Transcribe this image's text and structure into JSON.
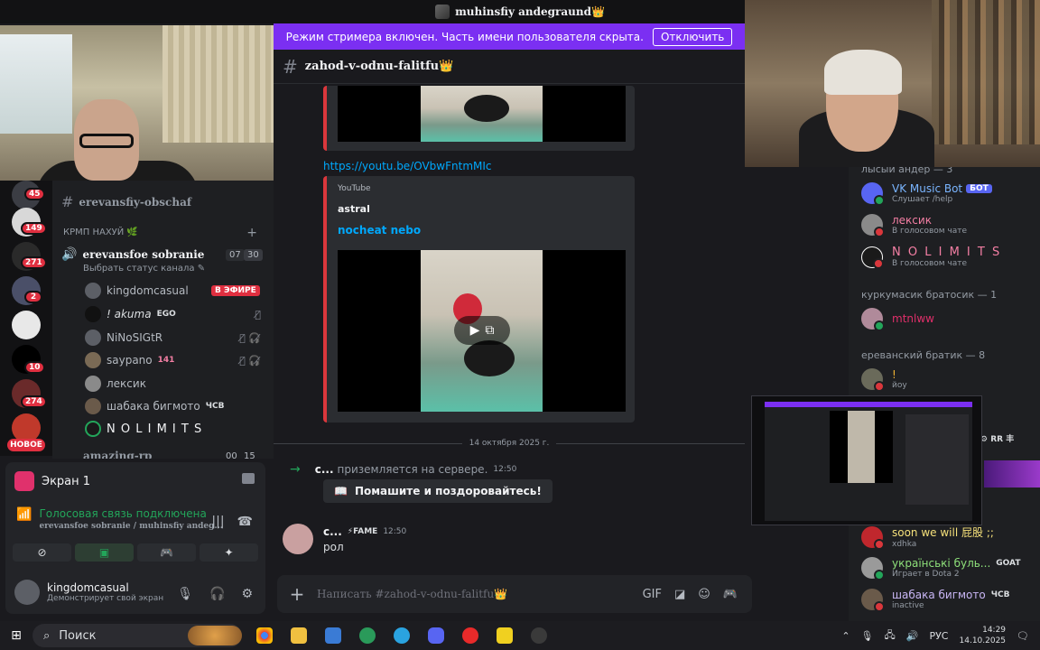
{
  "titlebar": {
    "title": "muhinsfiy andegraund👑"
  },
  "banner": {
    "text": "Режим стримера включен. Часть имени пользователя скрыта.",
    "button": "Отключить"
  },
  "servers": [
    {
      "badge": "45"
    },
    {
      "badge": "149"
    },
    {
      "badge": "271"
    },
    {
      "badge": "2"
    },
    {
      "badge": ""
    },
    {
      "badge": "10"
    },
    {
      "badge": "274"
    },
    {
      "badge": ""
    }
  ],
  "new_badge": "НОВОЕ",
  "channels": {
    "text_channel": "erevansfiy-obschaf",
    "category": "КРМП НАХУЙ 🌿",
    "voice_channel": "erevansfoe sobranie",
    "voice_status": "Выбрать статус канала",
    "voice_counts": [
      "07",
      "30"
    ],
    "users": [
      {
        "name": "kingdomcasual",
        "extra": "В ЭФИРЕ"
      },
      {
        "name": "! akuma",
        "extra": "EGO"
      },
      {
        "name": "NiNoSIGtR",
        "extra": ""
      },
      {
        "name": "saypano",
        "extra": "141"
      },
      {
        "name": "лексик",
        "extra": ""
      },
      {
        "name": "шабака бигмото",
        "extra": "ЧСВ"
      },
      {
        "name": "N O L I M I T S",
        "extra": ""
      }
    ],
    "next_channel": "amazing-rp",
    "next_counts": [
      "00",
      "15"
    ]
  },
  "voice_panel": {
    "screen_title": "Экран 1",
    "connected": "Голосовая связь подключена",
    "connected_sub": "erevansfoe sobranie / muhinsfiy andeg...",
    "user_name": "kingdomcasual",
    "user_status": "Демонстрирует свой экран"
  },
  "chat": {
    "channel_name": "zahod-v-odnu-falitfu👑",
    "link": "https://youtu.be/OVbwFntmMIc",
    "embed_provider": "YouTube",
    "embed_author": "astral",
    "embed_title": "nocheat nebo",
    "date_separator": "14 октября 2025 г.",
    "join_user": "с...",
    "join_text": "приземляется на сервере.",
    "join_time": "12:50",
    "wave_button": "Помашите и поздоровайтесь!",
    "msg_user": "с...",
    "msg_tag": "FAME",
    "msg_time": "12:50",
    "msg_text": "рол",
    "composer_placeholder": "Написать #zahod-v-odnu-falitfu👑"
  },
  "members": {
    "cat1": "лысыи андер — 3",
    "bot_name": "VK Music Bot",
    "bot_tag": "БОТ",
    "bot_status": "Слушает /help",
    "m1_name": "лексик",
    "m1_status": "В голосовом чате",
    "m2_name": "N O L I M I T S",
    "m2_status": "В голосовом чате",
    "cat2": "куркумасик братосик — 1",
    "m3_name": "mtnlww",
    "cat3": "ереванский братик — 8",
    "m4_name": "!",
    "m4_status": "йоу",
    "m5_name": "soon we will 屁股 ;;",
    "m5_status": "xdhka",
    "m6_name": "українські буль...",
    "m6_tag": "GOAT",
    "m6_status": "Играет в Dota 2",
    "m7_name": "шабака бигмото",
    "m7_tag": "ЧСВ",
    "m7_status": "inactive",
    "rr_tag": "RR"
  },
  "taskbar": {
    "search": "Поиск",
    "lang": "РУС",
    "time": "14:29",
    "date": "14.10.2025"
  }
}
